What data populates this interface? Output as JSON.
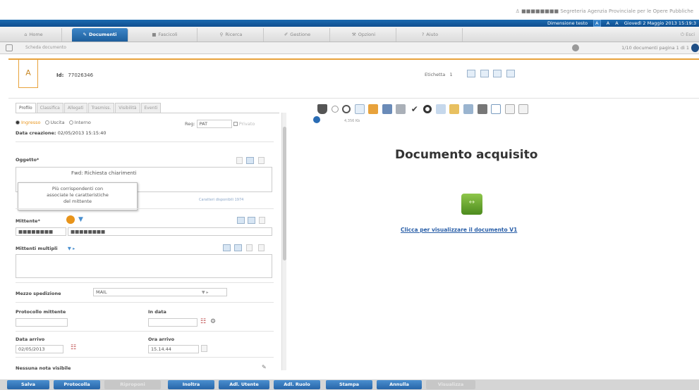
{
  "topbar": {
    "user_name": "■■■■■■■■",
    "user_role": "Segreteria Agenzia Provinciale per le Opere Pubbliche"
  },
  "bluebar": {
    "text_size_label": "Dimensione testo",
    "font_sizes": [
      "A",
      "A",
      "A"
    ],
    "date": "Giovedì 2 Maggio 2013 15:19:3"
  },
  "tabs": [
    {
      "label": "Home",
      "icon": "home-icon"
    },
    {
      "label": "Documenti",
      "icon": "document-icon"
    },
    {
      "label": "Fascicoli",
      "icon": "folder-icon"
    },
    {
      "label": "Ricerca",
      "icon": "search-icon"
    },
    {
      "label": "Gestione",
      "icon": "pencil-icon"
    },
    {
      "label": "Opzioni",
      "icon": "wrench-icon"
    },
    {
      "label": "Aiuto",
      "icon": "help-icon"
    }
  ],
  "exit_label": "Esci",
  "subbar": {
    "breadcrumb": "Scheda documento",
    "pager": "1/10 documenti pagina 1 di 1"
  },
  "header": {
    "bookmark": "A",
    "id_label": "Id:",
    "id_value": "77026346",
    "etichetta_label": "Etichetta",
    "etichetta_value": "1"
  },
  "left_tabs": [
    "Profilo",
    "Classifica",
    "Allegati",
    "Trasmiss.",
    "Visibilità",
    "Eventi"
  ],
  "profile": {
    "direction_options": [
      "Ingresso",
      "Uscita",
      "Interno"
    ],
    "reg_label": "Reg:",
    "reg_value": "PAT",
    "privato_label": "Privato",
    "creation_label": "Data creazione:",
    "creation_value": "02/05/2013 15:15:40",
    "oggetto_label": "Oggetto*",
    "oggetto_value": "Fwd: Richiesta chiarimenti",
    "oggetto_counter": "Caratteri disponibili 1974",
    "tooltip": [
      "Più corrispondenti con",
      "associate le caratteristiche",
      "del mittente"
    ],
    "mittente_label": "Mittente*",
    "mittente_code": "■■■■■■■■",
    "mittente_name": "■■■■■■■■",
    "mittenti_multipli_label": "Mittenti multipli",
    "mezzo_label": "Mezzo spedizione",
    "mezzo_value": "MAIL",
    "protocollo_mittente_label": "Protocollo mittente",
    "in_data_label": "In data",
    "data_arrivo_label": "Data arrivo",
    "data_arrivo_value": "02/05/2013",
    "ora_arrivo_label": "Ora arrivo",
    "ora_arrivo_value": "15.14.44",
    "nessuna_nota": "Nessuna nota visibile"
  },
  "viewer": {
    "zoom": "4,356 Kb",
    "title": "Documento acquisito",
    "link": "Clicca per visualizzare il documento V1"
  },
  "bottom_buttons": [
    {
      "label": "Salva",
      "enabled": true
    },
    {
      "label": "Protocolla",
      "enabled": true
    },
    {
      "label": "Riproponi",
      "enabled": false
    },
    {
      "label": "Inoltra",
      "enabled": true
    },
    {
      "label": "Adl. Utente",
      "enabled": true
    },
    {
      "label": "Adl. Ruolo",
      "enabled": true
    },
    {
      "label": "Stampa",
      "enabled": true
    },
    {
      "label": "Annulla",
      "enabled": true
    },
    {
      "label": "Visualizza",
      "enabled": false
    }
  ],
  "colors": {
    "accent_blue": "#1c6ab0",
    "accent_orange": "#e8a23b",
    "doc_green": "#6aa832"
  }
}
